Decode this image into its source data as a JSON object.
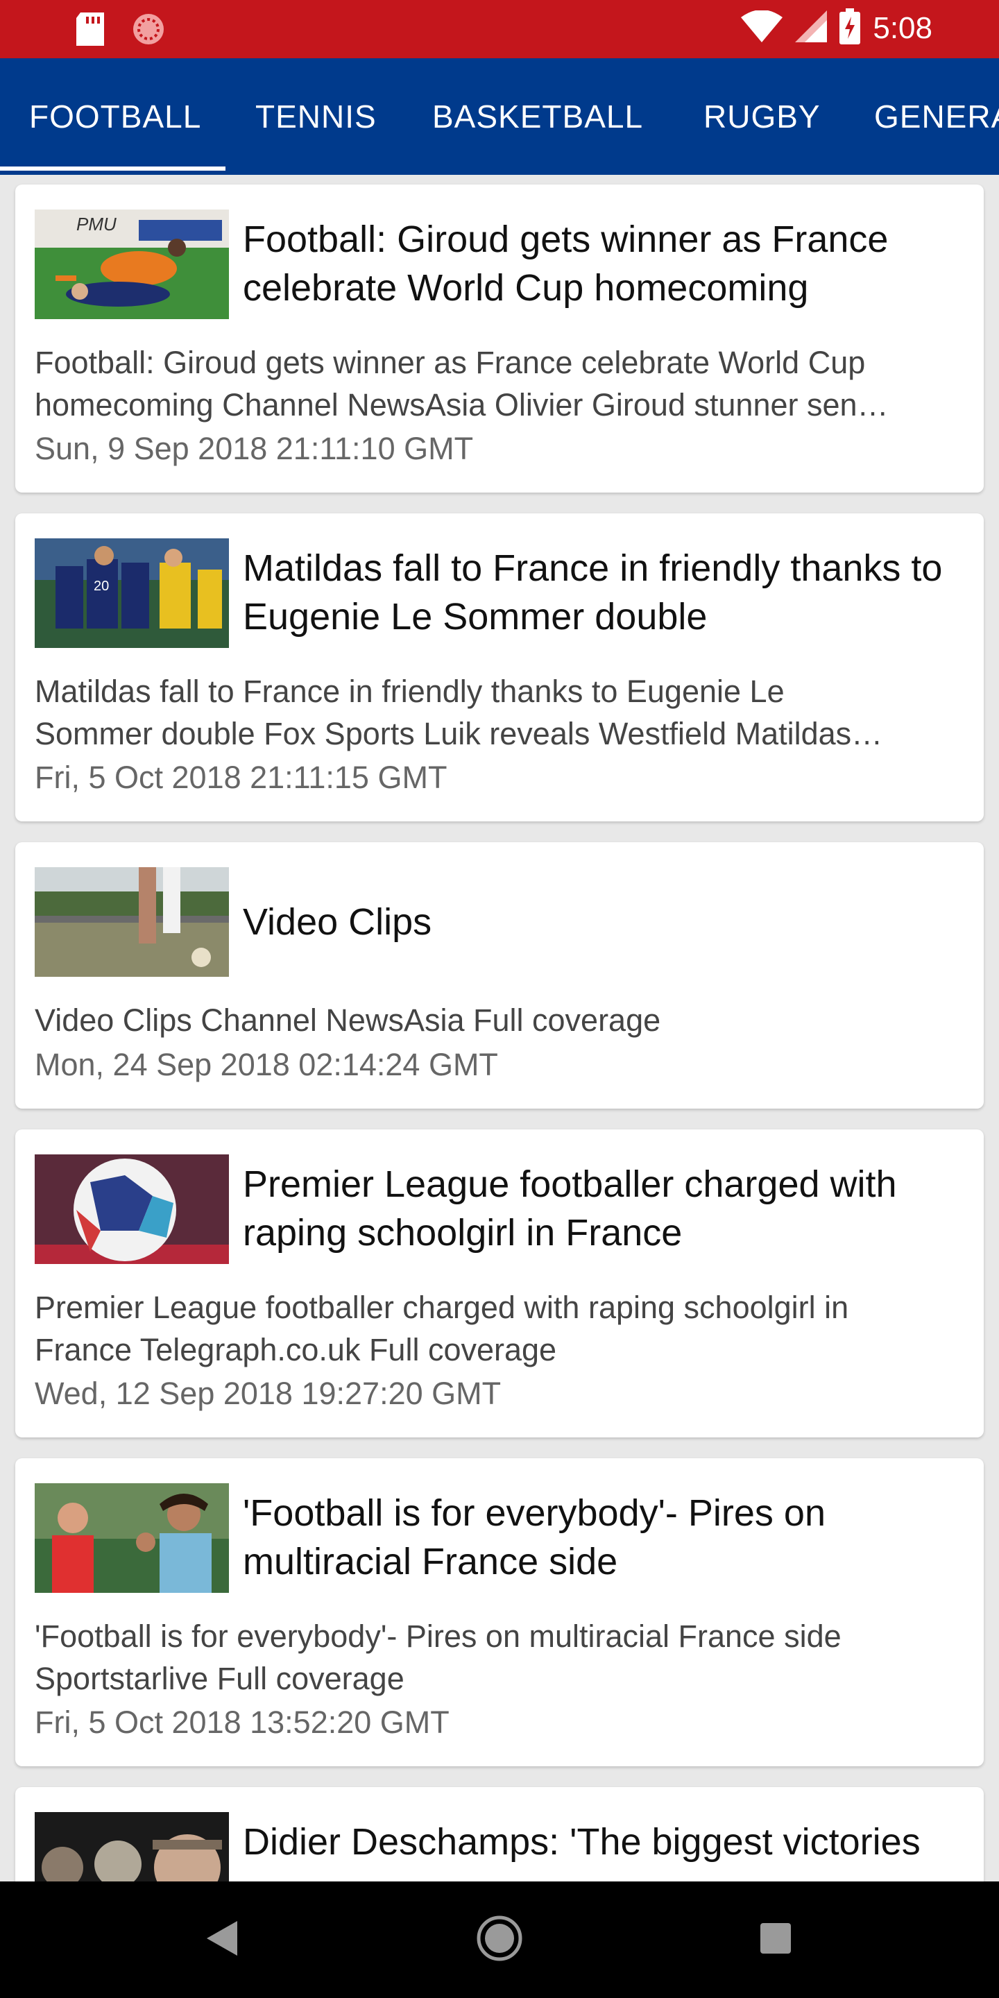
{
  "status_bar": {
    "time": "5:08",
    "icons": [
      "sd-card-icon",
      "sync-icon",
      "wifi-icon",
      "signal-icon",
      "battery-icon"
    ],
    "color": "#c4161c"
  },
  "tabs": [
    {
      "label": "FOOTBALL",
      "active": true
    },
    {
      "label": "TENNIS",
      "active": false
    },
    {
      "label": "BASKETBALL",
      "active": false
    },
    {
      "label": "RUGBY",
      "active": false
    },
    {
      "label": "GENERA",
      "active": false
    }
  ],
  "tab_bar_color": "#003a8c",
  "articles": [
    {
      "headline": "Football: Giroud gets winner as France celebrate World Cup homecoming",
      "summary_line1": "Football: Giroud gets winner as France celebrate World Cup",
      "summary_line2": "homecoming  Channel NewsAsia  Olivier Giroud stunner sen…",
      "date": "Sun, 9 Sep 2018 21:11:10 GMT",
      "thumb": "football-match-photo"
    },
    {
      "headline": "Matildas fall to France in friendly thanks to Eugenie Le Sommer double",
      "summary_line1": "Matildas fall to France in friendly thanks to Eugenie Le",
      "summary_line2": "Sommer double  Fox Sports  Luik reveals Westfield Matildas…",
      "date": "Fri, 5 Oct 2018 21:11:15 GMT",
      "thumb": "women-football-photo"
    },
    {
      "headline": "Video Clips",
      "summary_line1": "Video Clips  Channel NewsAsia  Full coverage",
      "summary_line2": "",
      "date": "Mon, 24 Sep 2018 02:14:24 GMT",
      "thumb": "field-photo"
    },
    {
      "headline": "Premier League footballer charged with raping schoolgirl in France",
      "summary_line1": "Premier League footballer charged with raping schoolgirl in",
      "summary_line2": "France  Telegraph.co.uk  Full coverage",
      "date": "Wed, 12 Sep 2018 19:27:20 GMT",
      "thumb": "ball-photo"
    },
    {
      "headline": "'Football is for everybody'- Pires on multiracial France side",
      "summary_line1": "'Football is for everybody'- Pires on multiracial France side",
      "summary_line2": "Sportstarlive  Full coverage",
      "date": "Fri, 5 Oct 2018 13:52:20 GMT",
      "thumb": "pires-photo"
    },
    {
      "headline": "Didier Deschamps: 'The biggest victories",
      "thumb": "deschamps-photo"
    }
  ],
  "nav_bar": {
    "buttons": [
      "back-icon",
      "home-icon",
      "recents-icon"
    ]
  }
}
